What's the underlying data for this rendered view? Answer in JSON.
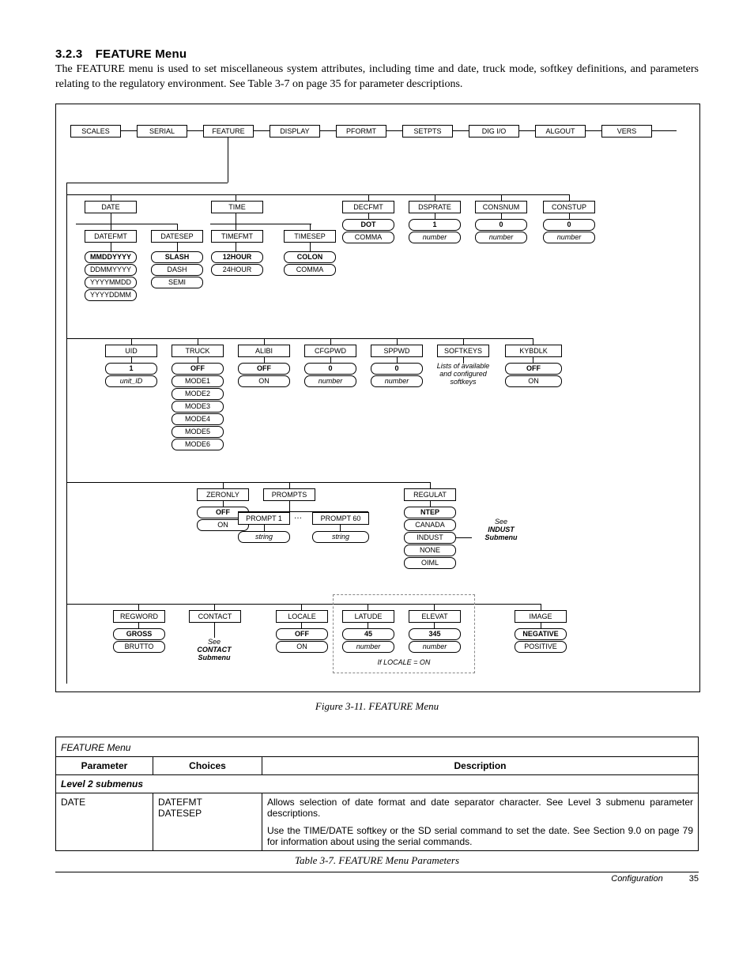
{
  "section": {
    "number": "3.2.3",
    "title": "FEATURE Menu"
  },
  "intro": "The FEATURE menu is used to set miscellaneous system attributes, including time and date, truck mode, softkey definitions, and parameters relating to the regulatory environment. See Table 3-7 on page 35 for parameter descriptions.",
  "fig_caption": "Figure 3-11. FEATURE Menu",
  "top_menu": [
    "SCALES",
    "SERIAL",
    "FEATURE",
    "DISPLAY",
    "PFORMT",
    "SETPTS",
    "DIG I/O",
    "ALGOUT",
    "VERS"
  ],
  "row1": {
    "items": [
      "DATE",
      "TIME",
      "DECFMT",
      "DSPRATE",
      "CONSNUM",
      "CONSTUP"
    ],
    "date_sub": [
      "DATEFMT",
      "DATESEP"
    ],
    "time_sub": [
      "TIMEFMT",
      "TIMESEP"
    ],
    "datefmt_opts": [
      "MMDDYYYY",
      "DDMMYYYY",
      "YYYYMMDD",
      "YYYYDDMM"
    ],
    "datesep_opts": [
      "SLASH",
      "DASH",
      "SEMI"
    ],
    "timefmt_opts": [
      "12HOUR",
      "24HOUR"
    ],
    "timesep_opts": [
      "COLON",
      "COMMA"
    ],
    "decfmt_opts": [
      "DOT",
      "COMMA"
    ],
    "dsprate_opts": [
      "1",
      "number"
    ],
    "consnum_opts": [
      "0",
      "number"
    ],
    "constup_opts": [
      "0",
      "number"
    ]
  },
  "row2": {
    "items": [
      "UID",
      "TRUCK",
      "ALIBI",
      "CFGPWD",
      "SPPWD",
      "SOFTKEYS",
      "KYBDLK"
    ],
    "uid_opts": [
      "1",
      "unit_ID"
    ],
    "truck_opts": [
      "OFF",
      "MODE1",
      "MODE2",
      "MODE3",
      "MODE4",
      "MODE5",
      "MODE6"
    ],
    "alibi_opts": [
      "OFF",
      "ON"
    ],
    "cfgpwd_opts": [
      "0",
      "number"
    ],
    "sppwd_opts": [
      "0",
      "number"
    ],
    "softkeys_note": "Lists of available and configured softkeys",
    "kybdlk_opts": [
      "OFF",
      "ON"
    ]
  },
  "row3": {
    "items": [
      "ZERONLY",
      "PROMPTS",
      "REGULAT"
    ],
    "zeronly_opts": [
      "OFF",
      "ON"
    ],
    "prompts_opts": [
      "PROMPT 1",
      "…",
      "PROMPT 60"
    ],
    "prompts_under": [
      "string",
      "string"
    ],
    "regulat_opts": [
      "NTEP",
      "CANADA",
      "INDUST",
      "NONE",
      "OIML"
    ],
    "regulat_note_1": "See",
    "regulat_note_2": "INDUST",
    "regulat_note_3": "Submenu"
  },
  "row4": {
    "items": [
      "REGWORD",
      "CONTACT",
      "LOCALE",
      "LATUDE",
      "ELEVAT",
      "IMAGE"
    ],
    "regword_opts": [
      "GROSS",
      "BRUTTO"
    ],
    "contact_note_1": "See",
    "contact_note_2": "CONTACT",
    "contact_note_3": "Submenu",
    "locale_opts": [
      "OFF",
      "ON"
    ],
    "latude_opts": [
      "45",
      "number"
    ],
    "elevat_opts": [
      "345",
      "number"
    ],
    "image_opts": [
      "NEGATIVE",
      "POSITIVE"
    ],
    "locale_note": "If LOCALE = ON"
  },
  "table": {
    "title": "FEATURE Menu",
    "headers": [
      "Parameter",
      "Choices",
      "Description"
    ],
    "subhead": "Level 2 submenus",
    "row": {
      "param": "DATE",
      "choices": "DATEFMT\nDATESEP",
      "desc1": "Allows selection of date format and date separator character. See Level 3 submenu parameter descriptions.",
      "desc2": "Use the TIME/DATE softkey or the SD serial command to set the date. See Section 9.0 on page 79 for information about using the serial commands."
    },
    "caption": "Table 3-7. FEATURE Menu Parameters"
  },
  "footer": {
    "label": "Configuration",
    "page": "35"
  }
}
